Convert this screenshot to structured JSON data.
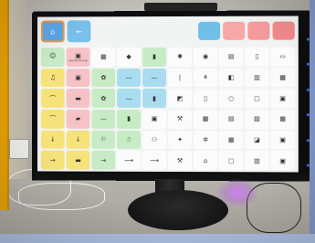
{
  "screen": {
    "home_icon": "home-icon",
    "back_icon": "back-arrow-icon",
    "top_right_tiles": [
      "#6fbfe8",
      "#f7a7a7",
      "#f59a9a",
      "#f28a8a"
    ],
    "colors": {
      "yellow": "#f5e27a",
      "pink": "#f6c2c6",
      "green": "#c7ebc4",
      "blue": "#a9dcef",
      "white": "#fbfbfb"
    },
    "rows": [
      [
        {
          "c": "green",
          "i": "☺",
          "l": "I"
        },
        {
          "c": "pink",
          "i": "▣",
          "l": "goodmorning"
        },
        {
          "c": "white",
          "i": "▦",
          "l": ""
        },
        {
          "c": "white",
          "i": "◆",
          "l": ""
        },
        {
          "c": "green",
          "i": "▮",
          "l": ""
        },
        {
          "c": "white",
          "i": "✺",
          "l": ""
        },
        {
          "c": "white",
          "i": "◉",
          "l": ""
        },
        {
          "c": "white",
          "i": "▤",
          "l": ""
        },
        {
          "c": "white",
          "i": "▯",
          "l": ""
        },
        {
          "c": "white",
          "i": "▭",
          "l": ""
        }
      ],
      [
        {
          "c": "yellow",
          "i": "♫",
          "l": ""
        },
        {
          "c": "pink",
          "i": "▣",
          "l": ""
        },
        {
          "c": "green",
          "i": "✿",
          "l": ""
        },
        {
          "c": "blue",
          "i": "—",
          "l": ""
        },
        {
          "c": "blue",
          "i": "—",
          "l": ""
        },
        {
          "c": "white",
          "i": "❘",
          "l": ""
        },
        {
          "c": "white",
          "i": "⚘",
          "l": ""
        },
        {
          "c": "white",
          "i": "◧",
          "l": ""
        },
        {
          "c": "white",
          "i": "▥",
          "l": ""
        },
        {
          "c": "white",
          "i": "▩",
          "l": ""
        }
      ],
      [
        {
          "c": "yellow",
          "i": "⌒",
          "l": ""
        },
        {
          "c": "pink",
          "i": "▬",
          "l": ""
        },
        {
          "c": "green",
          "i": "✿",
          "l": ""
        },
        {
          "c": "blue",
          "i": "—",
          "l": ""
        },
        {
          "c": "blue",
          "i": "▮",
          "l": ""
        },
        {
          "c": "white",
          "i": "◩",
          "l": ""
        },
        {
          "c": "white",
          "i": "▯",
          "l": ""
        },
        {
          "c": "white",
          "i": "○",
          "l": ""
        },
        {
          "c": "white",
          "i": "▢",
          "l": ""
        },
        {
          "c": "white",
          "i": "▣",
          "l": ""
        }
      ],
      [
        {
          "c": "yellow",
          "i": "⌒",
          "l": ""
        },
        {
          "c": "pink",
          "i": "▰",
          "l": ""
        },
        {
          "c": "green",
          "i": "—",
          "l": ""
        },
        {
          "c": "green",
          "i": "▮",
          "l": ""
        },
        {
          "c": "white",
          "i": "▣",
          "l": ""
        },
        {
          "c": "white",
          "i": "⚒",
          "l": ""
        },
        {
          "c": "white",
          "i": "▦",
          "l": ""
        },
        {
          "c": "white",
          "i": "▤",
          "l": ""
        },
        {
          "c": "white",
          "i": "▨",
          "l": ""
        },
        {
          "c": "white",
          "i": "▦",
          "l": ""
        }
      ],
      [
        {
          "c": "yellow",
          "i": "↓",
          "l": ""
        },
        {
          "c": "yellow",
          "i": "↓",
          "l": ""
        },
        {
          "c": "green",
          "i": "⚐",
          "l": ""
        },
        {
          "c": "green",
          "i": "☃",
          "l": ""
        },
        {
          "c": "white",
          "i": "⚇",
          "l": ""
        },
        {
          "c": "white",
          "i": "✦",
          "l": ""
        },
        {
          "c": "white",
          "i": "✲",
          "l": ""
        },
        {
          "c": "white",
          "i": "▦",
          "l": ""
        },
        {
          "c": "white",
          "i": "◪",
          "l": ""
        },
        {
          "c": "white",
          "i": "▣",
          "l": ""
        }
      ],
      [
        {
          "c": "yellow",
          "i": "→",
          "l": ""
        },
        {
          "c": "yellow",
          "i": "▬",
          "l": ""
        },
        {
          "c": "green",
          "i": "→",
          "l": ""
        },
        {
          "c": "white",
          "i": "⟶",
          "l": ""
        },
        {
          "c": "white",
          "i": "⟶",
          "l": ""
        },
        {
          "c": "white",
          "i": "⚒",
          "l": ""
        },
        {
          "c": "white",
          "i": "⌂",
          "l": ""
        },
        {
          "c": "white",
          "i": "▢",
          "l": ""
        },
        {
          "c": "white",
          "i": "▥",
          "l": ""
        },
        {
          "c": "white",
          "i": "▣",
          "l": ""
        }
      ]
    ]
  }
}
